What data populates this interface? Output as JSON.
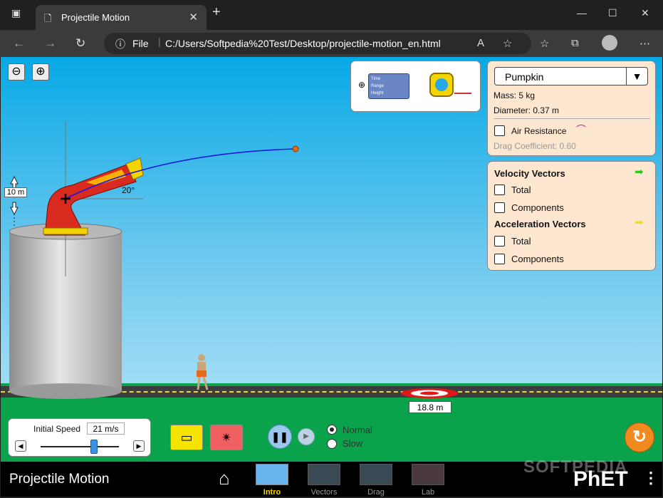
{
  "browser": {
    "tab_title": "Projectile Motion",
    "file_label": "File",
    "url": "C:/Users/Softpedia%20Test/Desktop/projectile-motion_en.html"
  },
  "sim": {
    "height_label": "10 m",
    "angle_label": "20°",
    "distance_label": "18.8 m",
    "tools_panel": {
      "time_label": "Time",
      "range_label": "Range",
      "height_label": "Height"
    },
    "projectile_panel": {
      "selected": "Pumpkin",
      "mass": "Mass: 5 kg",
      "diameter": "Diameter: 0.37 m",
      "air_resistance": "Air Resistance",
      "drag_coefficient": "Drag Coefficient: 0.60"
    },
    "vectors_panel": {
      "velocity_title": "Velocity Vectors",
      "velocity_total": "Total",
      "velocity_components": "Components",
      "acceleration_title": "Acceleration Vectors",
      "acceleration_total": "Total",
      "acceleration_components": "Components"
    },
    "speed_panel": {
      "label": "Initial Speed",
      "value": "21 m/s"
    },
    "speed_slider_fraction": 0.68,
    "play_speed": {
      "normal": "Normal",
      "slow": "Slow",
      "selected": "Normal"
    },
    "footer": {
      "title": "Projectile Motion",
      "screens": [
        "Intro",
        "Vectors",
        "Drag",
        "Lab"
      ],
      "active_screen": "Intro",
      "brand": "PhET"
    },
    "watermark": "SOFTPEDIA"
  },
  "colors": {
    "accent_yellow": "#ffd400",
    "trajectory": "#1a1ad6",
    "panel_bg": "#fde7d0"
  }
}
